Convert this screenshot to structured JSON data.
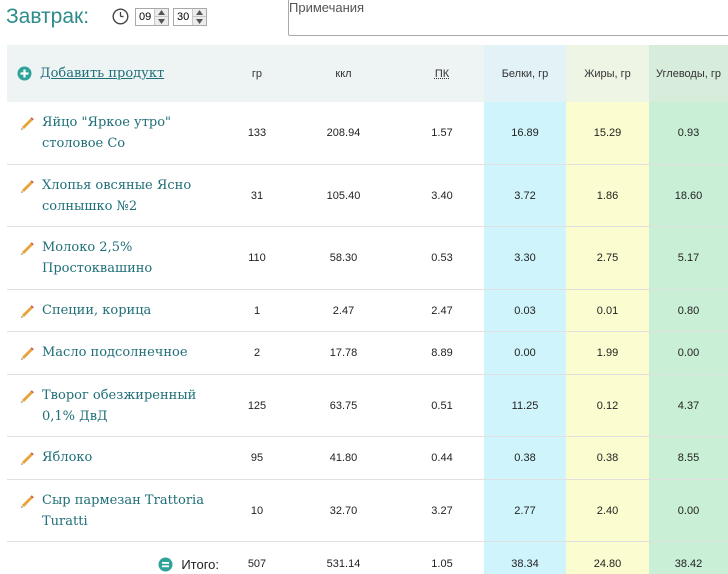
{
  "meal": {
    "title": "Завтрак:",
    "hour": "09",
    "minute": "30",
    "notes_placeholder": "Примечания"
  },
  "table": {
    "add_product": "Добавить продукт",
    "headers": {
      "gr": "гр",
      "kcal": "ккл",
      "pk": "ПК",
      "protein": "Белки, гр",
      "fat": "Жиры, гр",
      "carbs": "Углеводы, гр"
    },
    "rows": [
      {
        "name": "Яйцо \"Яркое утро\" столовое Со",
        "gr": "133",
        "kcal": "208.94",
        "pk": "1.57",
        "protein": "16.89",
        "fat": "15.29",
        "carbs": "0.93"
      },
      {
        "name": "Хлопья овсяные Ясно солнышко №2",
        "gr": "31",
        "kcal": "105.40",
        "pk": "3.40",
        "protein": "3.72",
        "fat": "1.86",
        "carbs": "18.60"
      },
      {
        "name": "Молоко 2,5% Простоквашино",
        "gr": "110",
        "kcal": "58.30",
        "pk": "0.53",
        "protein": "3.30",
        "fat": "2.75",
        "carbs": "5.17"
      },
      {
        "name": "Специи, корица",
        "gr": "1",
        "kcal": "2.47",
        "pk": "2.47",
        "protein": "0.03",
        "fat": "0.01",
        "carbs": "0.80"
      },
      {
        "name": "Масло подсолнечное",
        "gr": "2",
        "kcal": "17.78",
        "pk": "8.89",
        "protein": "0.00",
        "fat": "1.99",
        "carbs": "0.00"
      },
      {
        "name": "Творог обезжиренный 0,1% ДвД",
        "gr": "125",
        "kcal": "63.75",
        "pk": "0.51",
        "protein": "11.25",
        "fat": "0.12",
        "carbs": "4.37"
      },
      {
        "name": "Яблоко",
        "gr": "95",
        "kcal": "41.80",
        "pk": "0.44",
        "protein": "0.38",
        "fat": "0.38",
        "carbs": "8.55"
      },
      {
        "name": "Сыр пармезан Trattoria Turatti",
        "gr": "10",
        "kcal": "32.70",
        "pk": "3.27",
        "protein": "2.77",
        "fat": "2.40",
        "carbs": "0.00"
      }
    ],
    "total": {
      "label": "Итого:",
      "gr": "507",
      "kcal": "531.14",
      "pk": "1.05",
      "protein": "38.34",
      "fat": "24.80",
      "carbs": "38.42"
    }
  },
  "colors": {
    "accent": "#2e8b8b",
    "protein_bg": "#cff4fb",
    "fat_bg": "#fbfdd0",
    "carbs_bg": "#c9efd6"
  },
  "icons": {
    "clock": "clock-icon",
    "add": "plus-circle-icon",
    "edit": "pencil-icon",
    "total": "equals-circle-icon"
  }
}
